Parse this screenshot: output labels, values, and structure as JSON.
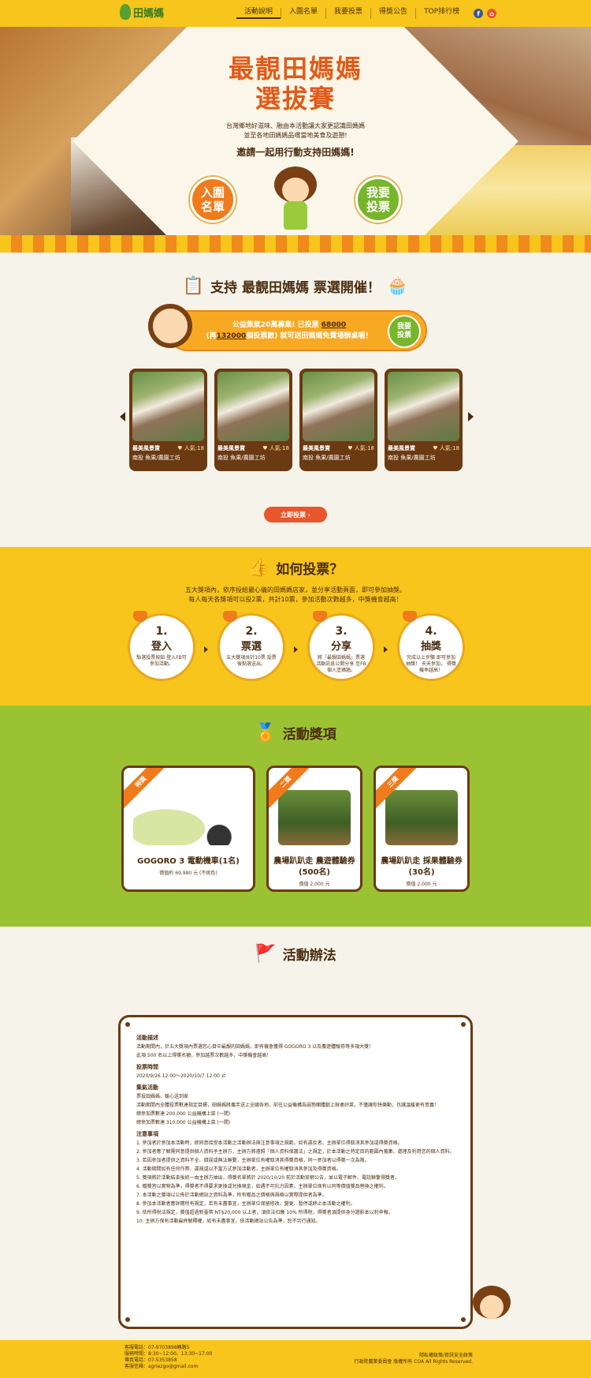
{
  "logo": {
    "text": "田媽媽"
  },
  "nav": {
    "items": [
      {
        "label": "活動說明",
        "active": true
      },
      {
        "label": "入圍名單"
      },
      {
        "label": "我要投票"
      },
      {
        "label": "得獎公告"
      },
      {
        "label": "TOP排行榜"
      }
    ],
    "social": {
      "fb": "f",
      "home": "⌂"
    }
  },
  "hero": {
    "title_line1": "最靚田媽媽",
    "title_line2": "選拔賽",
    "desc_line1": "台灣鄉地好滋味、融由本活動讓大家更認識田媽媽",
    "desc_line2": "並至各地田媽媽品嚐當地美食及遊憩!",
    "invite": "邀請一起用行動支持田媽媽!",
    "btn_left": "入圍\n名單",
    "btn_right": "我要\n投票"
  },
  "support": {
    "title": "支持 最靚田媽媽 票選開催！",
    "bar_line1_a": "公益集氣20萬募集!",
    "bar_line1_b": "已投票 ",
    "bar_votes": "68000",
    "bar_line2_a": "(再",
    "bar_remaining": "132000",
    "bar_line2_b": "個投票數) 就可送田媽媽免費場辦桌喔！",
    "bar_btn": "我要\n投票",
    "cards": [
      {
        "title": "最美風景賞",
        "votes": "♥ 人氣:18",
        "sub": "南投 魚果/農園工坊"
      },
      {
        "title": "最美風景賞",
        "votes": "♥ 人氣:18",
        "sub": "南投 魚果/農園工坊"
      },
      {
        "title": "最美風景賞",
        "votes": "♥ 人氣:18",
        "sub": "南投 魚果/農園工坊"
      },
      {
        "title": "最美風景賞",
        "votes": "♥ 人氣:18",
        "sub": "南投 魚果/農園工坊"
      }
    ],
    "vote_now": "立即投票 ›"
  },
  "how": {
    "title": "如何投票？",
    "desc_line1": "五大獎項內，依序投給最心儀的田媽媽店家，並分享活動頁面，即可參加抽獎。",
    "desc_line2": "每人每天各獎項可以投2票，共計10票，參加活動次數越多，中獎機會越高！",
    "steps": [
      {
        "num": "1.",
        "name": "登入",
        "desc": "點選投票按鈕 登入FB可參加活動。"
      },
      {
        "num": "2.",
        "name": "票選",
        "desc": "五大獎項共計10票 投票後點選送出。"
      },
      {
        "num": "3.",
        "name": "分享",
        "desc": "將「最靚田媽媽」票選活動訊息公開分享 至FB個人塗鴉牆。"
      },
      {
        "num": "4.",
        "name": "抽獎",
        "desc": "完成以上步驟 即可參加抽獎！ 天天參加， 得獎機率越高！"
      }
    ]
  },
  "prizes": {
    "title": "活動獎項",
    "items": [
      {
        "ribbon": "特獎",
        "name": "GOGORO 3 電動機車(1名)",
        "price": "價值約 69,980 元 (不挑色)"
      },
      {
        "ribbon": "二獎",
        "name": "農場趴趴走 農遊體驗券 (500名)",
        "price": "價值 2,000 元"
      },
      {
        "ribbon": "三獎",
        "name": "農場趴趴走 採果體驗券 (30名)",
        "price": "價值 2,000 元"
      }
    ]
  },
  "rules": {
    "title": "活動辦法",
    "h1": "活動描述",
    "p1": "活動期間內，於五大獎項內票選您心目中最靚的田媽媽，即有機會獲得 GOGORO 3 以及農遊體驗券等多項大獎！",
    "p1b": "此項 500 名以上得獎名額，參加越票次數越多，中獎機會越高！",
    "h2": "投票時間",
    "p2": "2020/9/26 12:00～2020/10/7 12:00 止",
    "h3": "集氣活動",
    "p3": "票投田媽媽、暖心送到家",
    "p3b": "活動期間內全體投票數達指定目標，田媽媽將攜手送上全國各地，前往公益機構為弱勢團體獻上辦桌好菜，不僅讓你快樂動，也讓溫暖更有意義！",
    "p3c": "總參加票數達 200,000 公益機構上菜 (一間)",
    "p3d": "總參加票數達 310,000 公益機構上菜 (一間)",
    "h4": "注意事項",
    "notes": [
      "1. 參加者於參加本活動時，即同意接受本活動之活動辦法與注意事項之規範，如有違反者，主辦單位得取消其參加或得獎資格。",
      "2. 參加者應了解需同意提供個人資料予主辦方，主辦方將遵照「個人資料保護法」之規定，於本活動之特定目的範圍內蒐集、處理及利用您的個人資料。",
      "3. 若因參加者提供之資料不全、錯誤或無法聯繫，主辦單位有權取消其得獎資格，同一參加者以得獎一次為限。",
      "4. 活動期間如有任何作弊、違規或以不當方式參加活動者，主辦單位有權取消其參加及得獎資格。",
      "5. 獎項將於活動結束後統一由主辦方抽出，得獎名單將於 2020/10/20 前於活動官網公告，並以電子郵件、電話聯繫得獎者。",
      "6. 贈獎皆以實物為準，得獎者不得要求更換或兌換現金，如遇不可抗力因素，主辦單位保有以同等價值獎品替換之權利。",
      "7. 本活動之獎項以公佈於活動網站之資料為準，所有贈品之價格與規格以實際提供者為準。",
      "8. 參加本活動者應詳閱所有規定，若有未盡事宜，主辦單位保留修改、變更、暫停或終止本活動之權利。",
      "9. 依所得稅法規定，獎值超過新臺幣 NT$20,000 以上者，須依法扣繳 10% 所得稅，得獎者須提供身分證影本以利申報。",
      "10. 主辦方保有活動最終解釋權，如有未盡事宜，依活動網站公告為準，恕不另行通知。"
    ]
  },
  "footer": {
    "left": [
      "客服電話：07-9703898轉路5",
      "服務時間：8:30~12:00、13:30~17:00",
      "傳真電話：07-5353858",
      "客服信箱：agriezgo@gmail.com"
    ],
    "right": [
      "隱私權政策/資訊安全政策",
      "行政院農業委員會 版權所有 COA All Rights Reserved."
    ]
  }
}
